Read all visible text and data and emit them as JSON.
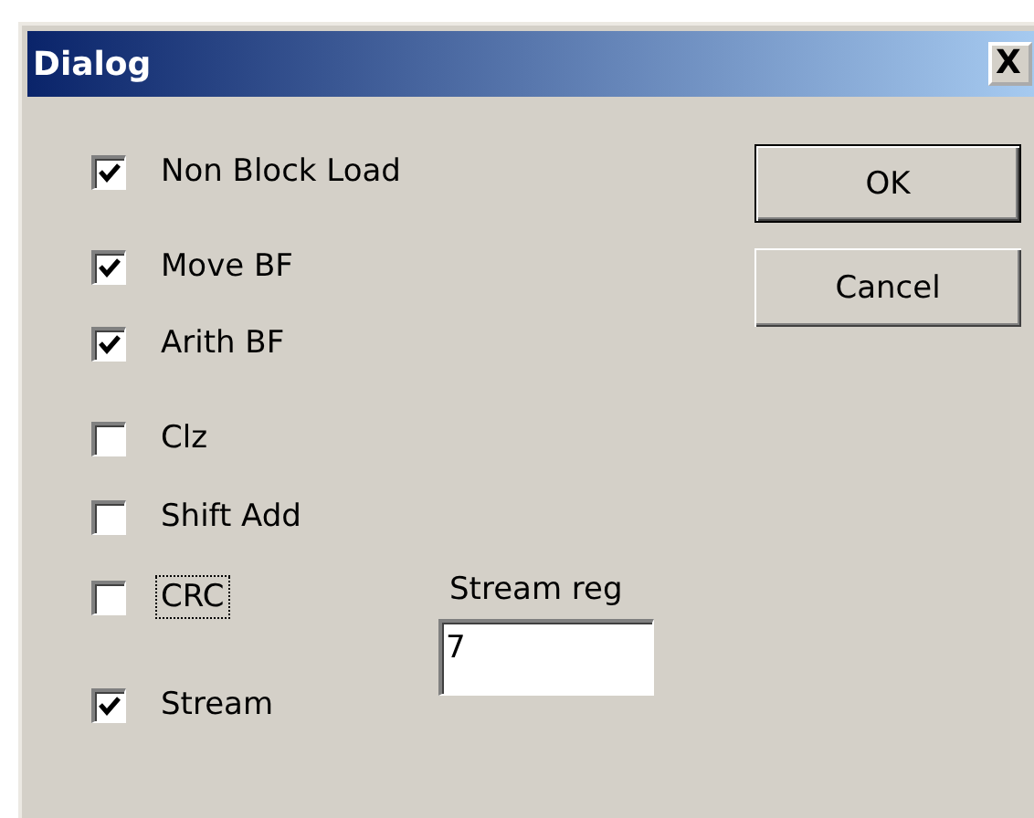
{
  "window": {
    "title": "Dialog",
    "close": "X"
  },
  "options": [
    {
      "label": "Non Block Load",
      "checked": true,
      "focused": false
    },
    {
      "label": "Move BF",
      "checked": true,
      "focused": false
    },
    {
      "label": "Arith BF",
      "checked": true,
      "focused": false
    },
    {
      "label": "Clz",
      "checked": false,
      "focused": false
    },
    {
      "label": "Shift Add",
      "checked": false,
      "focused": false
    },
    {
      "label": "CRC",
      "checked": false,
      "focused": true
    },
    {
      "label": "Stream",
      "checked": true,
      "focused": false
    }
  ],
  "stream_reg": {
    "label": "Stream reg",
    "value": "7"
  },
  "buttons": [
    {
      "label": "OK",
      "default": true
    },
    {
      "label": "Cancel",
      "default": false
    }
  ]
}
